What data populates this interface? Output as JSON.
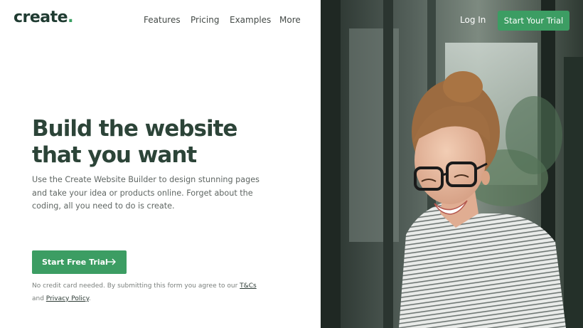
{
  "brand": {
    "name": "create",
    "dot": "."
  },
  "nav": {
    "items": [
      {
        "label": "Features"
      },
      {
        "label": "Pricing"
      },
      {
        "label": "Examples"
      },
      {
        "label": "More"
      }
    ],
    "login_label": "Log In",
    "trial_label": "Start Your Trial"
  },
  "hero": {
    "title": "Build the website that you want",
    "description": "Use the Create Website Builder to design stunning pages and take your idea or products online. Forget about the coding, all you need to do is create.",
    "cta_label": "Start Free Trial",
    "cta_icon": "arrow-right-icon",
    "fine_print_prefix": "No credit card needed. By submitting this form you agree to our ",
    "terms_link": "T&Cs",
    "fine_print_and": " and ",
    "privacy_link": "Privacy Policy",
    "fine_print_suffix": "."
  },
  "colors": {
    "accent": "#3c9d63",
    "heading": "#2c4438",
    "logo": "#1f3b31",
    "body_text": "#5f6663"
  }
}
